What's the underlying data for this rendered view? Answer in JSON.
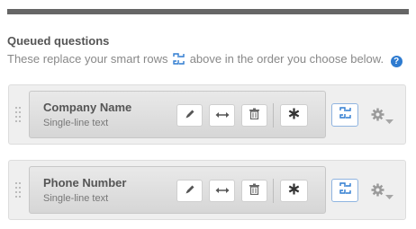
{
  "section": {
    "title": "Queued questions",
    "subtitle_before": "These replace your smart rows",
    "subtitle_after": "above in the order you choose below.",
    "help_label": "?"
  },
  "questions": [
    {
      "name": "Company Name",
      "type": "Single-line text"
    },
    {
      "name": "Phone Number",
      "type": "Single-line text"
    }
  ],
  "icons": {
    "edit": "pencil-icon",
    "width": "resize-horizontal-icon",
    "delete": "trash-icon",
    "required": "asterisk-icon",
    "smart": "smart-row-icon",
    "settings": "gear-icon"
  },
  "colors": {
    "accent": "#2e7bd0",
    "top_bar": "#666666"
  }
}
